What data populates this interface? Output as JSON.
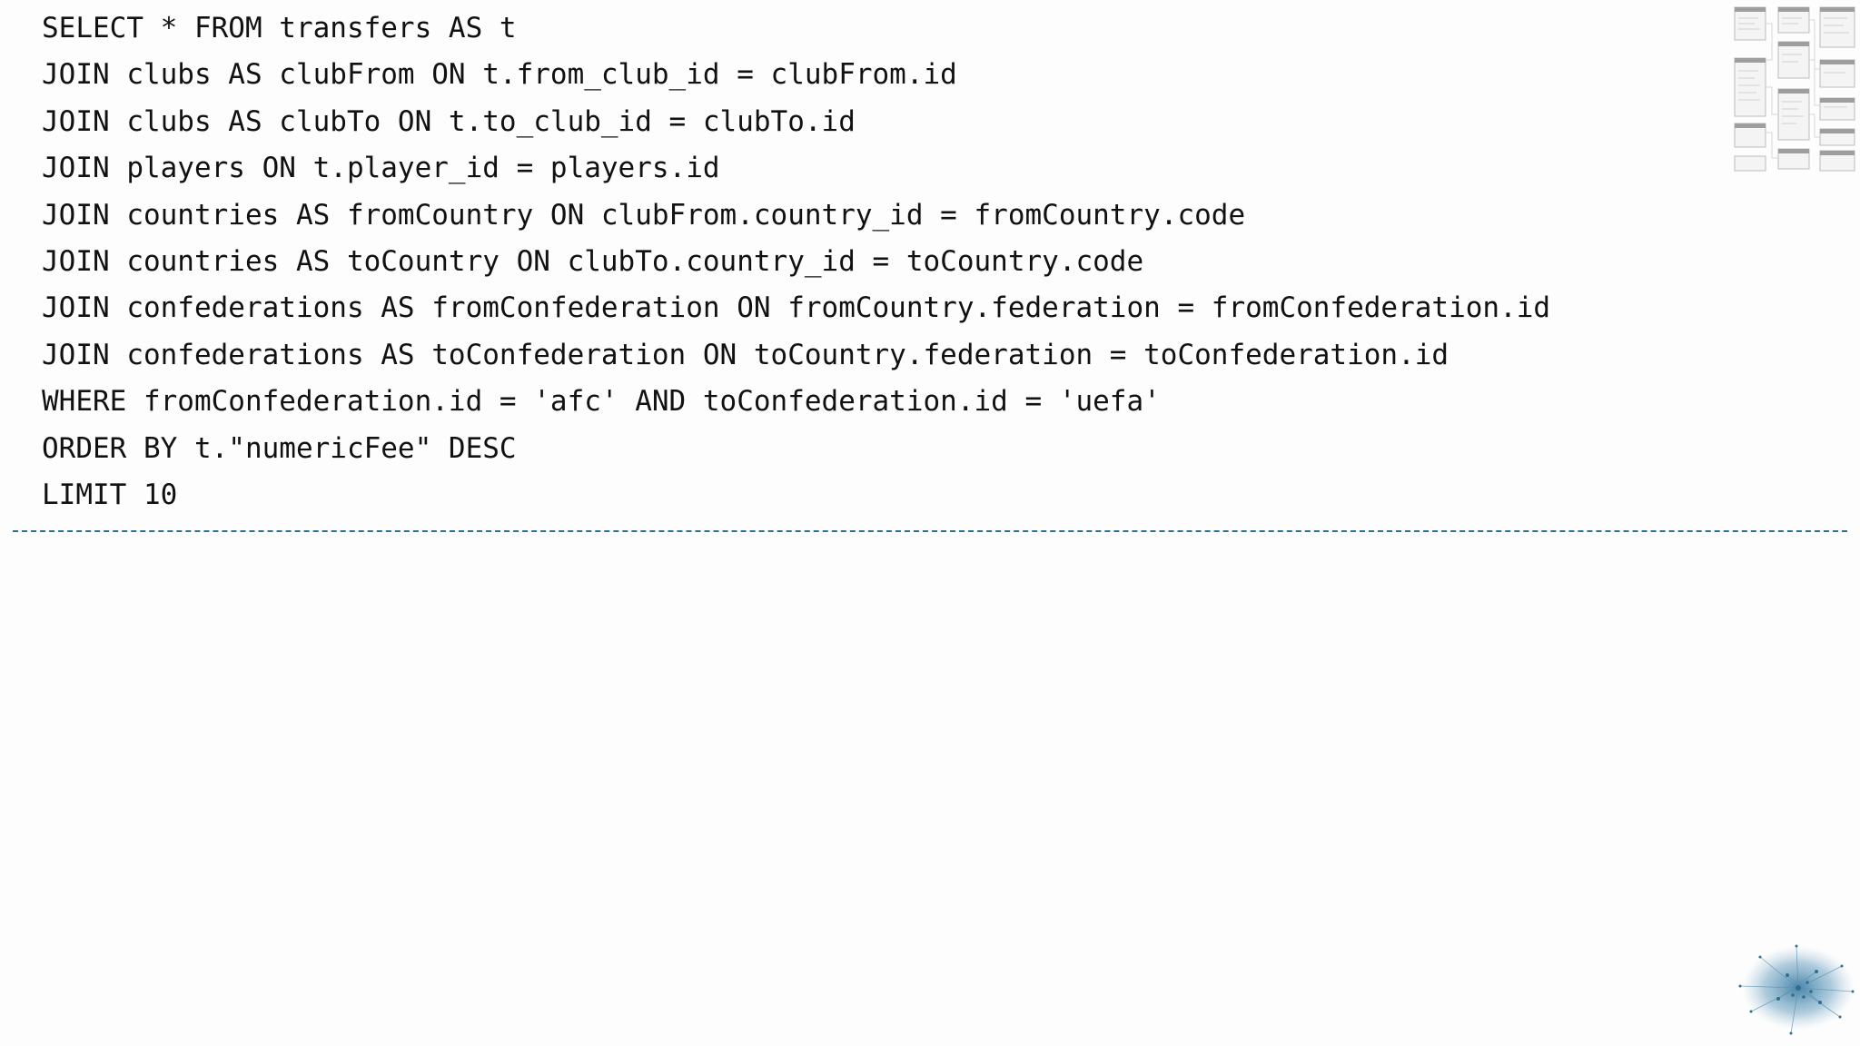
{
  "editor": {
    "lines": [
      "SELECT * FROM transfers AS t",
      "JOIN clubs AS clubFrom ON t.from_club_id = clubFrom.id",
      "JOIN clubs AS clubTo ON t.to_club_id = clubTo.id",
      "JOIN players ON t.player_id = players.id",
      "JOIN countries AS fromCountry ON clubFrom.country_id = fromCountry.code",
      "JOIN countries AS toCountry ON clubTo.country_id = toCountry.code",
      "JOIN confederations AS fromConfederation ON fromCountry.federation = fromConfederation.id",
      "JOIN confederations AS toConfederation ON toCountry.federation = toConfederation.id",
      "WHERE fromConfederation.id = 'afc' AND toConfederation.id = 'uefa'",
      "ORDER BY t.\"numericFee\" DESC",
      "LIMIT 10"
    ]
  },
  "colors": {
    "background": "#fdfdfd",
    "text": "#111111",
    "divider": "#2f6f8f",
    "graph_node": "#3d7fa6"
  },
  "icons": {
    "schema": "database-schema-thumbnail",
    "graph": "network-graph-thumbnail"
  }
}
